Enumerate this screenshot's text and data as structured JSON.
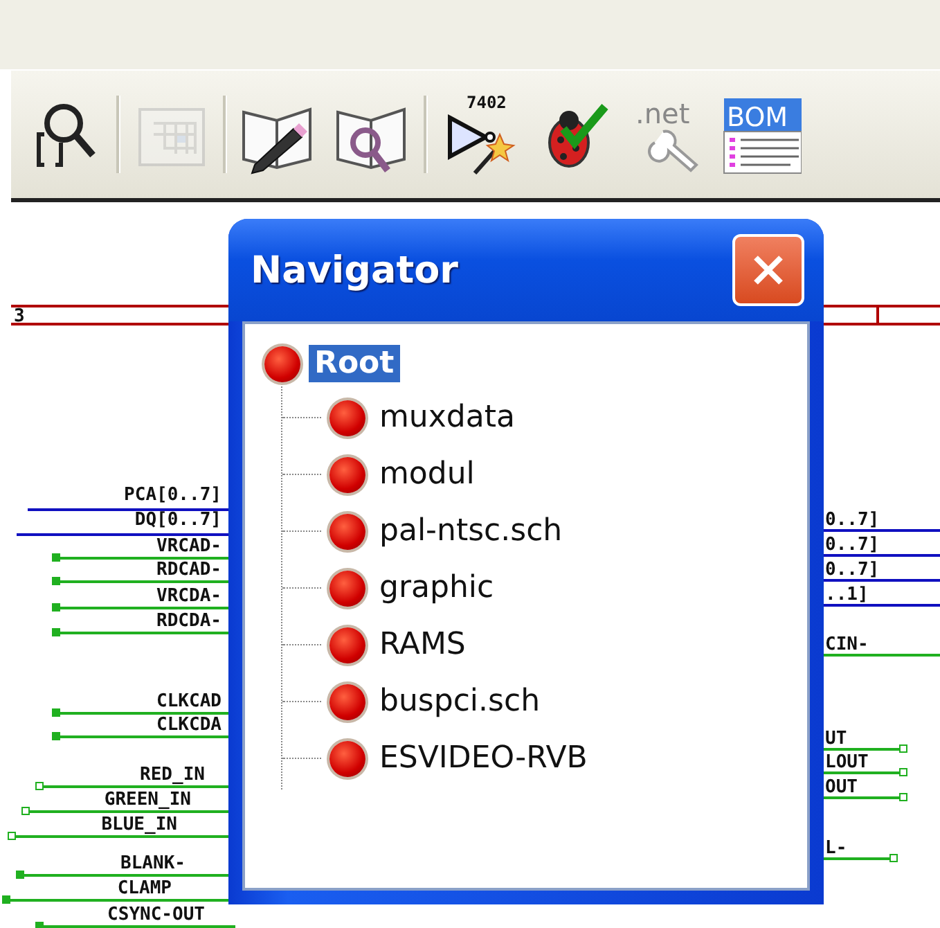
{
  "toolbar": [
    {
      "kind": "find",
      "disabled": false
    },
    {
      "kind": "hierarchy",
      "disabled": true
    },
    {
      "kind": "library-edit",
      "disabled": false
    },
    {
      "kind": "library-browse",
      "disabled": false
    },
    {
      "kind": "annotate",
      "disabled": false,
      "label": "7402"
    },
    {
      "kind": "erc",
      "disabled": false
    },
    {
      "kind": "netlist",
      "disabled": false,
      "label": ".net"
    },
    {
      "kind": "bom",
      "disabled": false,
      "label": "BOM"
    }
  ],
  "schematic": {
    "sheet_number": "3",
    "left_labels": [
      "PCA[0..7]",
      "DQ[0..7]",
      "VRCAD-",
      "RDCAD-",
      "VRCDA-",
      "RDCDA-",
      "CLKCAD",
      "CLKCDA",
      "RED_IN",
      "GREEN_IN",
      "BLUE_IN",
      "BLANK-",
      "CLAMP",
      "CSYNC-OUT"
    ],
    "right_labels": [
      "0..7]",
      "0..7]",
      "0..7]",
      "..1]",
      "CIN-",
      "UT",
      "LOUT",
      "OUT",
      "L-"
    ]
  },
  "navigator": {
    "title": "Navigator",
    "root": {
      "label": "Root",
      "selected": true,
      "children": [
        {
          "label": "muxdata",
          "selected": false
        },
        {
          "label": "modul",
          "selected": false
        },
        {
          "label": "pal-ntsc.sch",
          "selected": false
        },
        {
          "label": "graphic",
          "selected": false
        },
        {
          "label": "RAMS",
          "selected": false
        },
        {
          "label": "buspci.sch",
          "selected": false
        },
        {
          "label": "ESVIDEO-RVB",
          "selected": false
        }
      ]
    }
  }
}
